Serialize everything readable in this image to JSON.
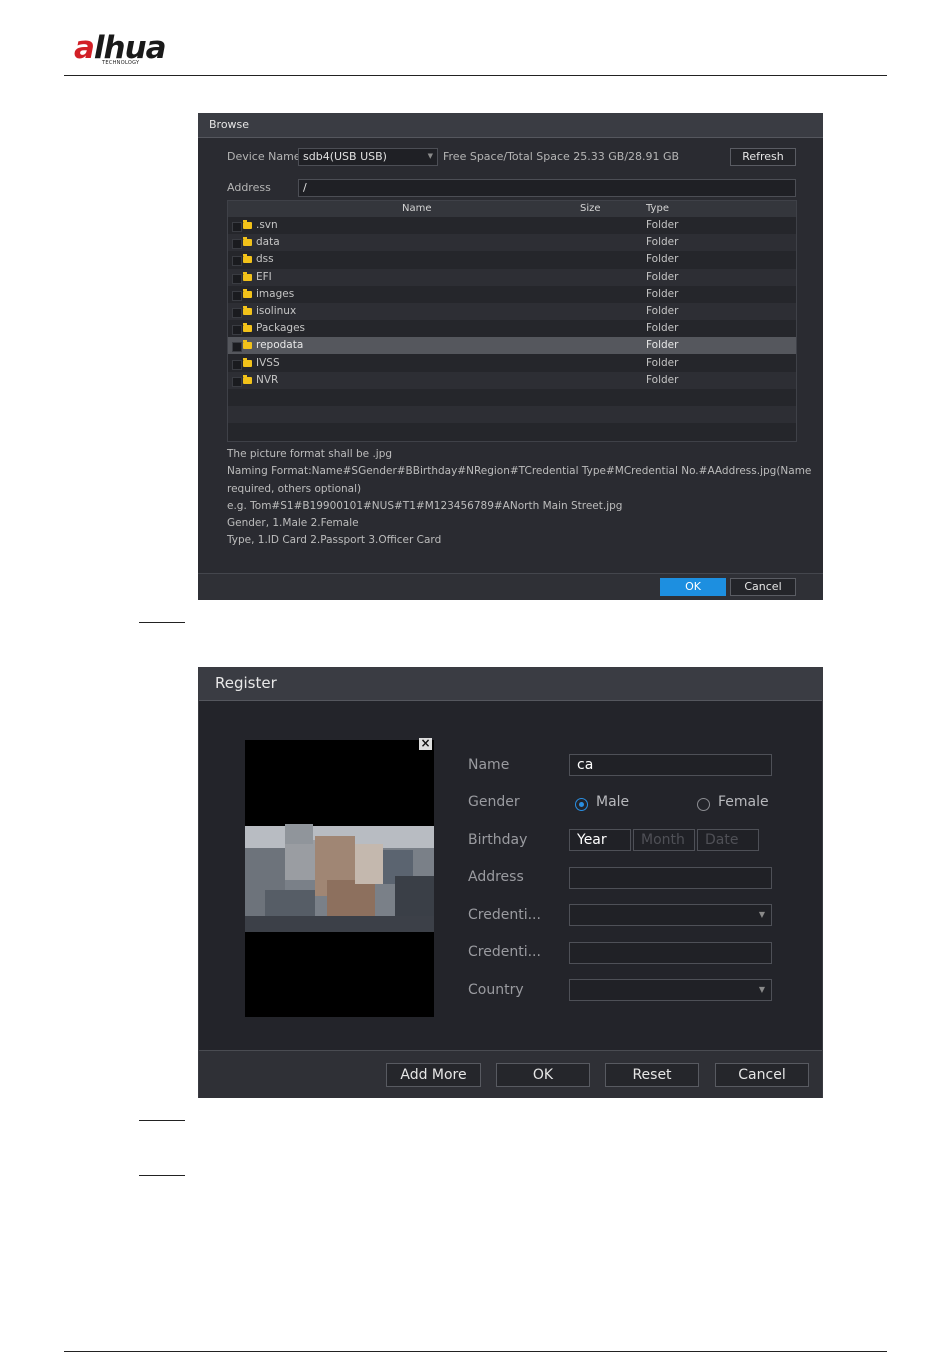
{
  "header": {
    "logo_a": "a",
    "logo_rest": "lhua",
    "logo_sub": "TECHNOLOGY"
  },
  "browse": {
    "title": "Browse",
    "device_name_label": "Device Name",
    "device_name_value": "sdb4(USB USB)",
    "space_text": "Free Space/Total Space 25.33 GB/28.91 GB",
    "refresh": "Refresh",
    "address_label": "Address",
    "address_value": "/",
    "columns": {
      "name": "Name",
      "size": "Size",
      "type": "Type"
    },
    "rows": [
      {
        "name": ".svn",
        "type": "Folder"
      },
      {
        "name": "data",
        "type": "Folder"
      },
      {
        "name": "dss",
        "type": "Folder"
      },
      {
        "name": "EFI",
        "type": "Folder"
      },
      {
        "name": "images",
        "type": "Folder"
      },
      {
        "name": "isolinux",
        "type": "Folder"
      },
      {
        "name": "Packages",
        "type": "Folder"
      },
      {
        "name": "repodata",
        "type": "Folder",
        "selected": true
      },
      {
        "name": "IVSS",
        "type": "Folder"
      },
      {
        "name": "NVR",
        "type": "Folder"
      }
    ],
    "notes": [
      "The picture format shall be .jpg",
      " Naming Format:Name#SGender#BBirthday#NRegion#TCredential Type#MCredential No.#AAddress.jpg(Name",
      "required, others optional)",
      "e.g. Tom#S1#B19900101#NUS#T1#M123456789#ANorth Main Street.jpg",
      "Gender, 1.Male 2.Female",
      "Type, 1.ID Card 2.Passport 3.Officer Card"
    ],
    "ok": "OK",
    "cancel": "Cancel",
    "selected_color": "#55575d",
    "accent": "#1d8fe0"
  },
  "register": {
    "title": "Register",
    "close_glyph": "×",
    "name_label": "Name",
    "name_value": "ca",
    "gender_label": "Gender",
    "male": "Male",
    "female": "Female",
    "gender_selected": "Male",
    "birthday_label": "Birthday",
    "year": "Year",
    "month": "Month",
    "date": "Date",
    "address_label": "Address",
    "credential_type_label": "Credenti...",
    "credential_no_label": "Credenti...",
    "country_label": "Country",
    "add_more": "Add More",
    "ok": "OK",
    "reset": "Reset",
    "cancel": "Cancel"
  }
}
